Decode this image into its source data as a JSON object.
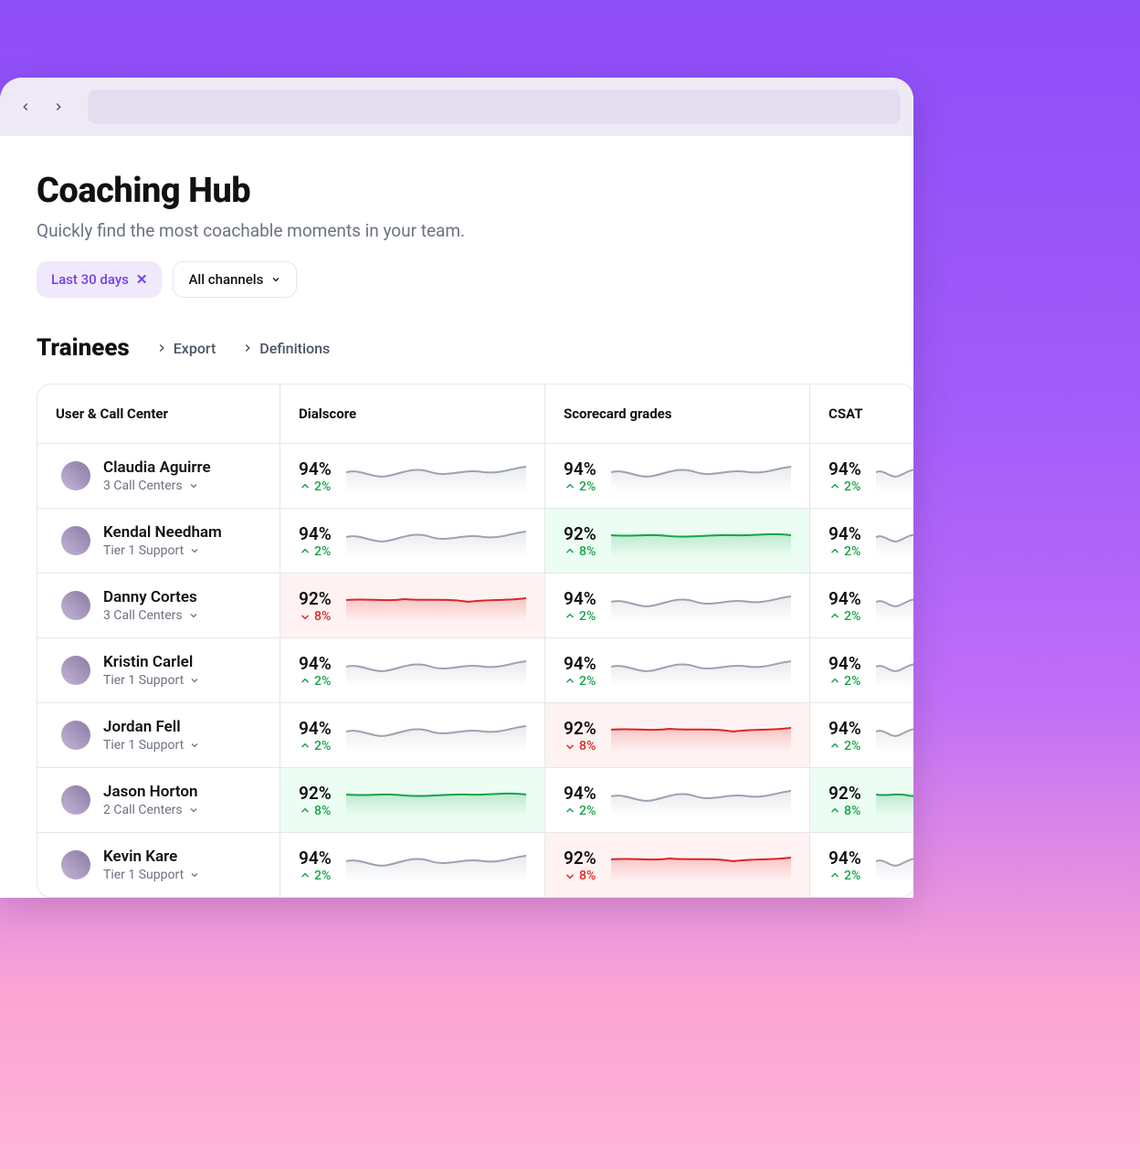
{
  "header": {
    "title": "Coaching Hub",
    "subtitle": "Quickly find the most coachable moments in your team."
  },
  "filters": {
    "date_range": "Last 30 days",
    "channel": "All channels"
  },
  "section": {
    "title": "Trainees",
    "export_label": "Export",
    "definitions_label": "Definitions"
  },
  "columns": {
    "user": "User & Call Center",
    "dialscore": "Dialscore",
    "scorecard": "Scorecard grades",
    "csat": "CSAT"
  },
  "rows": [
    {
      "name": "Claudia Aguirre",
      "center": "3 Call Centers",
      "dialscore": {
        "value": "94%",
        "delta": "2%",
        "dir": "up",
        "tone": "grey"
      },
      "scorecard": {
        "value": "94%",
        "delta": "2%",
        "dir": "up",
        "tone": "grey"
      },
      "csat": {
        "value": "94%",
        "delta": "2%",
        "dir": "up",
        "tone": "grey"
      }
    },
    {
      "name": "Kendal Needham",
      "center": "Tier 1 Support",
      "dialscore": {
        "value": "94%",
        "delta": "2%",
        "dir": "up",
        "tone": "grey"
      },
      "scorecard": {
        "value": "92%",
        "delta": "8%",
        "dir": "up",
        "tone": "green"
      },
      "csat": {
        "value": "94%",
        "delta": "2%",
        "dir": "up",
        "tone": "grey"
      }
    },
    {
      "name": "Danny Cortes",
      "center": "3 Call Centers",
      "dialscore": {
        "value": "92%",
        "delta": "8%",
        "dir": "down",
        "tone": "red"
      },
      "scorecard": {
        "value": "94%",
        "delta": "2%",
        "dir": "up",
        "tone": "grey"
      },
      "csat": {
        "value": "94%",
        "delta": "2%",
        "dir": "up",
        "tone": "grey"
      }
    },
    {
      "name": "Kristin Carlel",
      "center": "Tier 1 Support",
      "dialscore": {
        "value": "94%",
        "delta": "2%",
        "dir": "up",
        "tone": "grey"
      },
      "scorecard": {
        "value": "94%",
        "delta": "2%",
        "dir": "up",
        "tone": "grey"
      },
      "csat": {
        "value": "94%",
        "delta": "2%",
        "dir": "up",
        "tone": "grey"
      }
    },
    {
      "name": "Jordan Fell",
      "center": "Tier 1 Support",
      "dialscore": {
        "value": "94%",
        "delta": "2%",
        "dir": "up",
        "tone": "grey"
      },
      "scorecard": {
        "value": "92%",
        "delta": "8%",
        "dir": "down",
        "tone": "red"
      },
      "csat": {
        "value": "94%",
        "delta": "2%",
        "dir": "up",
        "tone": "grey"
      }
    },
    {
      "name": "Jason Horton",
      "center": "2 Call Centers",
      "dialscore": {
        "value": "92%",
        "delta": "8%",
        "dir": "up",
        "tone": "green"
      },
      "scorecard": {
        "value": "94%",
        "delta": "2%",
        "dir": "up",
        "tone": "grey"
      },
      "csat": {
        "value": "92%",
        "delta": "8%",
        "dir": "up",
        "tone": "green"
      }
    },
    {
      "name": "Kevin Kare",
      "center": "Tier 1 Support",
      "dialscore": {
        "value": "94%",
        "delta": "2%",
        "dir": "up",
        "tone": "grey"
      },
      "scorecard": {
        "value": "92%",
        "delta": "8%",
        "dir": "down",
        "tone": "red"
      },
      "csat": {
        "value": "94%",
        "delta": "2%",
        "dir": "up",
        "tone": "grey"
      }
    }
  ]
}
